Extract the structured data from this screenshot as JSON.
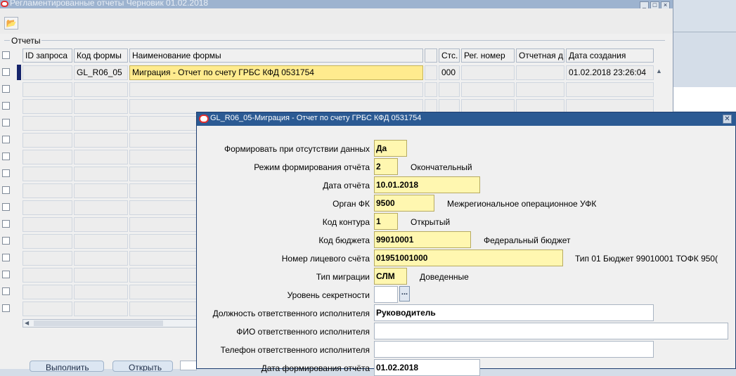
{
  "background_window": {
    "title": "Регламентированные отчеты Черновик 01.02.2018",
    "section_label": "Отчеты",
    "columns": [
      "ID запроса",
      "Код формы",
      "Наименование формы",
      "",
      "Стс.",
      "Рег. номер",
      "Отчетная д",
      "Дата создания"
    ],
    "row1": {
      "request_id": "",
      "form_code": "GL_R06_05",
      "form_name": "Миграция - Отчет по счету ГРБС КФД 0531754",
      "status": "000",
      "reg_number": "",
      "report_date": "",
      "created": "01.02.2018 23:26:04"
    },
    "bottom_buttons": [
      "Выполнить",
      "Открыть"
    ]
  },
  "dialog": {
    "title": "GL_R06_05-Миграция - Отчет по счету ГРБС КФД 0531754",
    "fields": {
      "no_data": {
        "label": "Формировать при отсутствии данных",
        "value": "Да"
      },
      "mode": {
        "label": "Режим формирования отчёта",
        "value": "2",
        "desc": "Окончательный"
      },
      "report_date": {
        "label": "Дата отчёта",
        "value": "10.01.2018"
      },
      "fk_organ": {
        "label": "Орган ФК",
        "value": "9500",
        "desc": "Межрегиональное операционное УФК"
      },
      "contour": {
        "label": "Код контура",
        "value": "1",
        "desc": "Открытый"
      },
      "budget": {
        "label": "Код бюджета",
        "value": "99010001",
        "desc": "Федеральный бюджет"
      },
      "account": {
        "label": "Номер лицевого счёта",
        "value": "01951001000",
        "desc": "Тип 01 Бюджет 99010001 ТОФК 950("
      },
      "migration_type": {
        "label": "Тип миграции",
        "value": "СЛМ",
        "desc": "Доведенные"
      },
      "secrecy": {
        "label": "Уровень секретности",
        "value": "",
        "lov": "..."
      },
      "position": {
        "label": "Должность ответственного исполнителя",
        "value": "Руководитель"
      },
      "fio": {
        "label": "ФИО ответственного исполнителя",
        "value": ""
      },
      "phone": {
        "label": "Телефон ответственного исполнителя",
        "value": ""
      },
      "form_date": {
        "label": "Дата формирования отчёта",
        "value": "01.02.2018"
      }
    },
    "close_icon": "close-icon"
  },
  "colors": {
    "dialog_title_bg": "#2b5a93",
    "field_yellow": "#fff7b0",
    "selected_cell": "#ffeb8e"
  }
}
